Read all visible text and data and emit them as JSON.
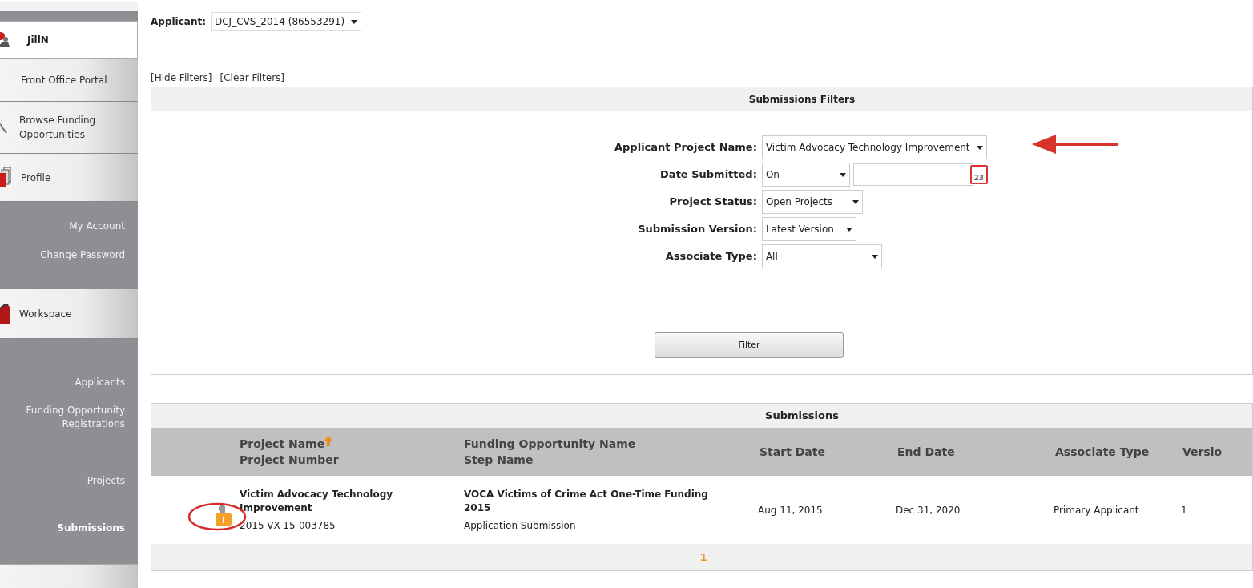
{
  "sidebar": {
    "user": "JillN",
    "items": [
      {
        "kind": "section",
        "label": "Front Office Portal",
        "selected": false
      },
      {
        "kind": "section",
        "label": "Browse Funding Opportunities",
        "selected": false
      },
      {
        "kind": "section",
        "label": "Profile",
        "selected": false
      },
      {
        "kind": "link",
        "label": "My Account",
        "selected": false
      },
      {
        "kind": "link",
        "label": "Change Password",
        "selected": false
      },
      {
        "kind": "section",
        "label": "Workspace",
        "selected": false
      },
      {
        "kind": "link",
        "label": "Applicants",
        "selected": false
      },
      {
        "kind": "link",
        "label": "Funding Opportunity Registrations",
        "selected": false
      },
      {
        "kind": "link",
        "label": "Projects",
        "selected": false
      },
      {
        "kind": "link",
        "label": "Submissions",
        "selected": true
      }
    ]
  },
  "applicant": {
    "label": "Applicant:",
    "value": "DCJ_CVS_2014 (86553291)"
  },
  "filter_links": [
    "[Hide Filters]",
    "[Clear Filters]"
  ],
  "filters": {
    "title": "Submissions Filters",
    "fields": [
      {
        "kind": "select",
        "label": "Applicant Project Name:",
        "value": "Victim Advocacy Technology Improvement"
      },
      {
        "kind": "date",
        "label": "Date Submitted:",
        "value": "On"
      },
      {
        "kind": "select",
        "label": "Project Status:",
        "value": "Open Projects"
      },
      {
        "kind": "select",
        "label": "Submission Version:",
        "value": "Latest Version"
      },
      {
        "kind": "select",
        "label": "Associate Type:",
        "value": "All"
      }
    ],
    "calendar_day": "23",
    "button": "Filter"
  },
  "submissions": {
    "title": "Submissions",
    "columns": [
      {
        "lines": [
          "Project Name",
          "Project Number"
        ],
        "sorted": true
      },
      {
        "lines": [
          "Funding Opportunity Name",
          "Step Name"
        ],
        "sorted": false
      },
      {
        "lines": [
          "Start Date"
        ],
        "sorted": false
      },
      {
        "lines": [
          "End Date"
        ],
        "sorted": false
      },
      {
        "lines": [
          "Associate Type"
        ],
        "sorted": false
      },
      {
        "lines": [
          "Versio"
        ],
        "sorted": false
      }
    ],
    "rows": [
      {
        "project_name": "Victim Advocacy Technology Improvement",
        "project_number": "2015-VX-15-003785",
        "funding_opportunity": "VOCA Victims of Crime Act One-Time Funding 2015",
        "step_name": "Application Submission",
        "start_date": "Aug 11, 2015",
        "end_date": "Dec 31, 2020",
        "associate_type": "Primary Applicant",
        "version": "1"
      }
    ],
    "pages": [
      {
        "label": "1",
        "selected": true
      }
    ]
  }
}
